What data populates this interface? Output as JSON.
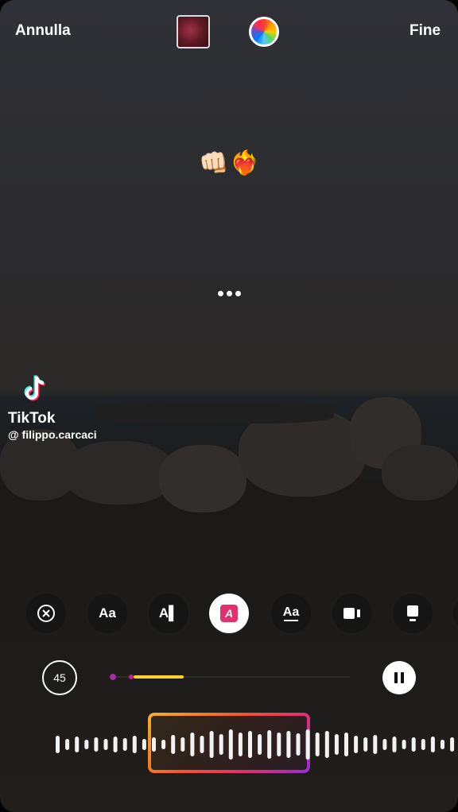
{
  "topbar": {
    "cancel_label": "Annulla",
    "done_label": "Fine"
  },
  "overlay": {
    "emoji": "👊🏻❤️‍🔥"
  },
  "watermark": {
    "brand": "TikTok",
    "user": "@ filippo.carcaci"
  },
  "tools": [
    {
      "name": "remove",
      "label": "⊗"
    },
    {
      "name": "font-size",
      "label": "Aa"
    },
    {
      "name": "lyrics-style",
      "label": "A▌"
    },
    {
      "name": "lyrics-highlight",
      "label": "A"
    },
    {
      "name": "text-style",
      "label": "Aa"
    },
    {
      "name": "video-card",
      "label": ""
    },
    {
      "name": "album-card",
      "label": ""
    }
  ],
  "audio": {
    "duration_label": "45",
    "selection_position": 0.28
  },
  "colors": {
    "accent_pink": "#e1306c",
    "accent_yellow": "#ffd32a"
  }
}
